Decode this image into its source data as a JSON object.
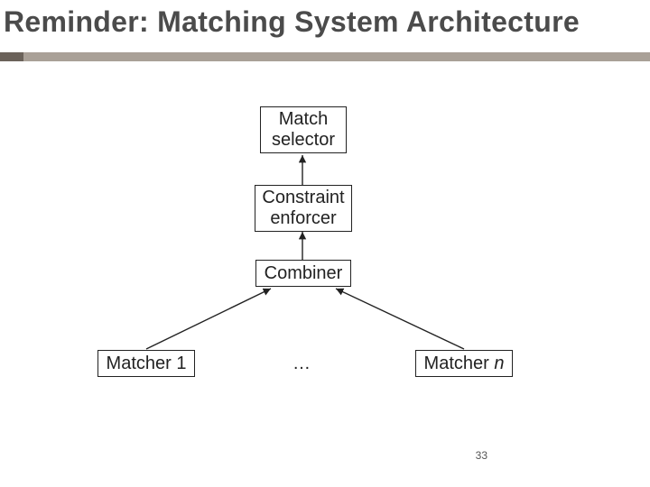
{
  "slide": {
    "title": "Reminder: Matching System Architecture",
    "page_number": "33"
  },
  "diagram": {
    "nodes": {
      "match_selector": {
        "line1": "Match",
        "line2": "selector"
      },
      "constraint_enforcer": {
        "line1": "Constraint",
        "line2": "enforcer"
      },
      "combiner": "Combiner",
      "matcher_1": "Matcher 1",
      "matcher_n_prefix": "Matcher ",
      "matcher_n_suffix": "n",
      "ellipsis": "…"
    }
  },
  "colors": {
    "title": "#4b4b4b",
    "underline": "#a9a097",
    "underline_accent": "#6b625a",
    "box_border": "#222222"
  }
}
